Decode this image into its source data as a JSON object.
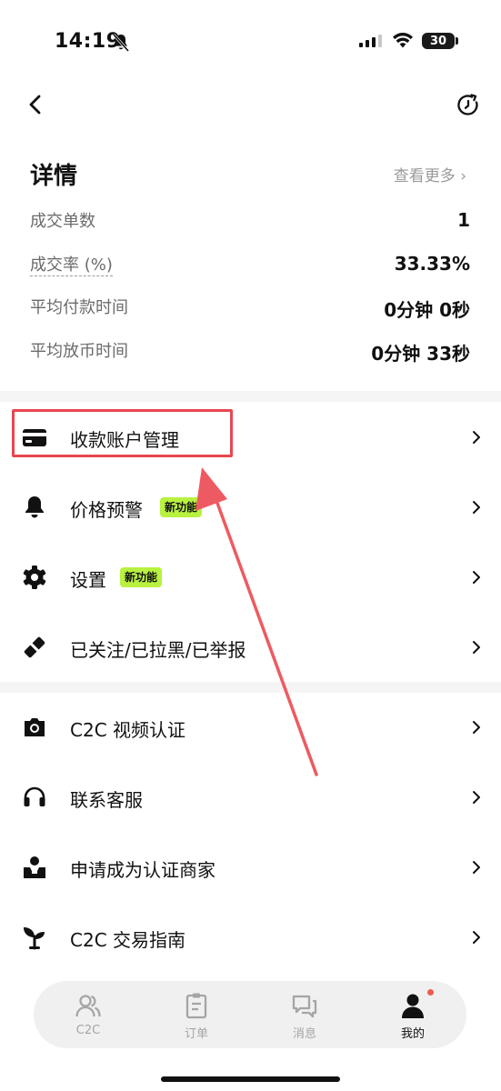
{
  "status": {
    "time": "14:19",
    "battery": "30"
  },
  "details": {
    "title": "详情",
    "see_more": "查看更多 ›",
    "stats": [
      {
        "label": "成交单数",
        "value": "1"
      },
      {
        "label": "成交率 (%)",
        "value": "33.33%"
      },
      {
        "label": "平均付款时间",
        "value": "0分钟 0秒"
      },
      {
        "label": "平均放币时间",
        "value": "0分钟 33秒"
      }
    ]
  },
  "menu": [
    {
      "label": "收款账户管理",
      "icon": "card-icon"
    },
    {
      "label": "价格预警",
      "icon": "bell-icon",
      "badge": "新功能"
    },
    {
      "label": "设置",
      "icon": "gear-icon",
      "badge": "新功能"
    },
    {
      "label": "已关注/已拉黑/已举报",
      "icon": "tag-icon"
    },
    {
      "label": "C2C 视频认证",
      "icon": "camera-icon"
    },
    {
      "label": "联系客服",
      "icon": "headset-icon"
    },
    {
      "label": "申请成为认证商家",
      "icon": "merchant-icon"
    },
    {
      "label": "C2C 交易指南",
      "icon": "sprout-icon"
    }
  ],
  "nav": [
    {
      "label": "C2C",
      "icon": "users-icon"
    },
    {
      "label": "订单",
      "icon": "clipboard-icon"
    },
    {
      "label": "消息",
      "icon": "messages-icon"
    },
    {
      "label": "我的",
      "icon": "person-icon",
      "active": true
    }
  ],
  "colors": {
    "accent_badge": "#b8f13f",
    "highlight": "#e8474f",
    "nav_dot": "#f05a4e"
  }
}
